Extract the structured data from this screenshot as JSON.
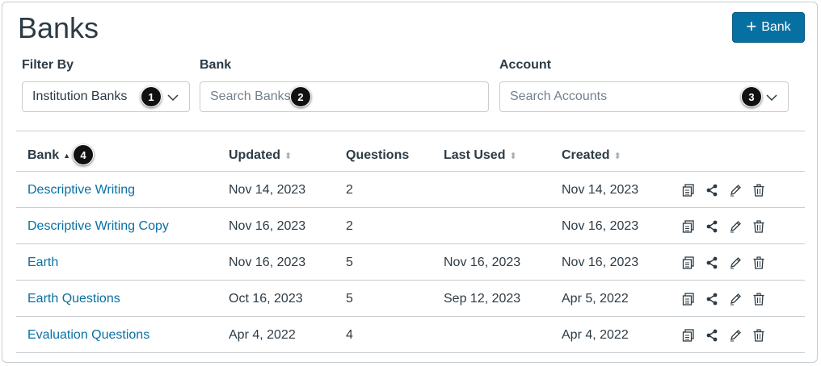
{
  "page": {
    "title": "Banks"
  },
  "add_button": {
    "label": "Bank",
    "icon": "plus-icon"
  },
  "filters": {
    "filter_by": {
      "label": "Filter By",
      "value": "Institution Banks"
    },
    "bank": {
      "label": "Bank",
      "placeholder": "Search Banks"
    },
    "account": {
      "label": "Account",
      "placeholder": "Search Accounts"
    }
  },
  "callouts": [
    "1",
    "2",
    "3",
    "4"
  ],
  "table": {
    "columns": [
      "Bank",
      "Updated",
      "Questions",
      "Last Used",
      "Created"
    ],
    "rows": [
      {
        "bank": "Descriptive Writing",
        "updated": "Nov 14, 2023",
        "questions": "2",
        "last_used": "",
        "created": "Nov 14, 2023"
      },
      {
        "bank": "Descriptive Writing Copy",
        "updated": "Nov 16, 2023",
        "questions": "2",
        "last_used": "",
        "created": "Nov 16, 2023"
      },
      {
        "bank": "Earth",
        "updated": "Nov 16, 2023",
        "questions": "5",
        "last_used": "Nov 16, 2023",
        "created": "Nov 16, 2023"
      },
      {
        "bank": "Earth Questions",
        "updated": "Oct 16, 2023",
        "questions": "5",
        "last_used": "Sep 12, 2023",
        "created": "Apr 5, 2022"
      },
      {
        "bank": "Evaluation Questions",
        "updated": "Apr 4, 2022",
        "questions": "4",
        "last_used": "",
        "created": "Apr 4, 2022"
      }
    ],
    "row_actions": [
      "copy-icon",
      "share-icon",
      "edit-icon",
      "trash-icon"
    ]
  },
  "colors": {
    "accent": "#0770a3",
    "text": "#2d3b45",
    "border": "#c7cdd1",
    "placeholder": "#73818c"
  }
}
